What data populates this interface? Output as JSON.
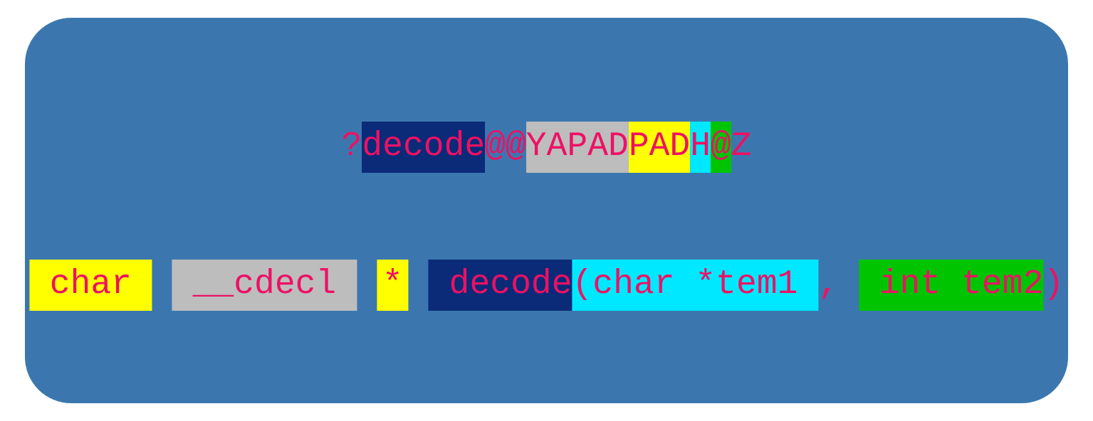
{
  "colors": {
    "panel_bg": "#3b77ae",
    "text": "#ed1164",
    "navy": "#0b2a78",
    "grey": "#bdbdbd",
    "yellow": "#ffff00",
    "cyan": "#00e8ff",
    "green": "#00c400"
  },
  "mangled": {
    "question": "?",
    "name": "decode",
    "sep": "@@",
    "call_ret": "YAPAD",
    "param1": "PAD",
    "param2": "H",
    "term": "@Z"
  },
  "demangled": {
    "ret_type": "char",
    "call_conv": "__cdecl",
    "ptr": "*",
    "name": "decode",
    "lparen": "(",
    "param1": "char *tem1",
    "comma": " ,",
    "param2": "int tem2",
    "rparen": ")"
  }
}
